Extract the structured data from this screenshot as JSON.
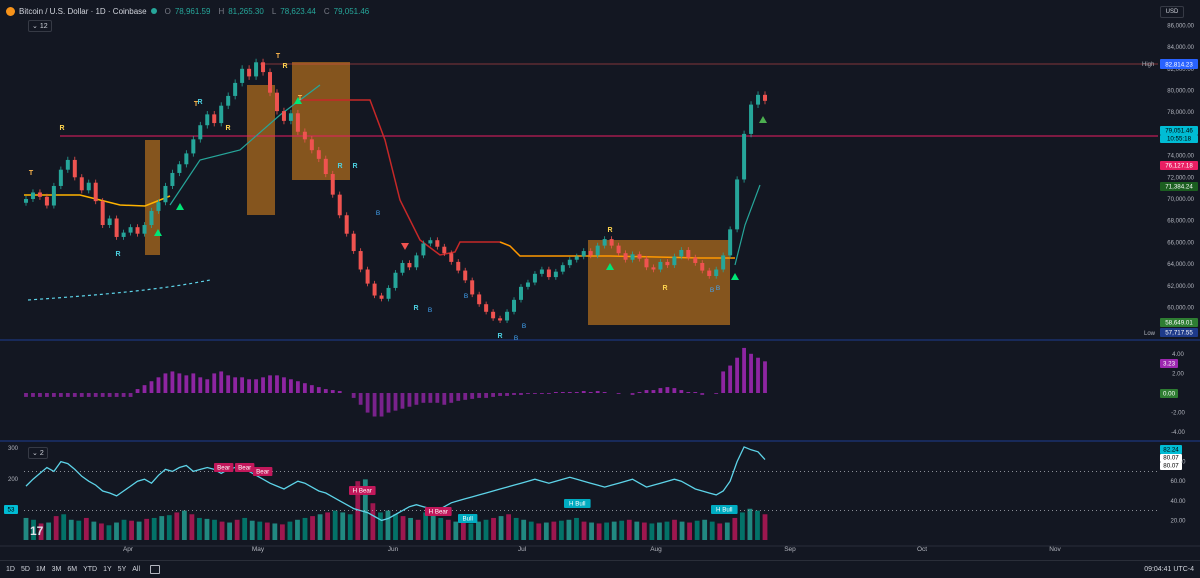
{
  "header": {
    "symbol": "Bitcoin / U.S. Dollar · 1D · Coinbase",
    "open_label": "O",
    "open": "78,961.59",
    "high_label": "H",
    "high": "81,265.30",
    "low_label": "L",
    "low": "78,623.44",
    "close_label": "C",
    "close": "79,051.46",
    "indicator_count": "12",
    "currency": "USD"
  },
  "indicator2": {
    "count": "2"
  },
  "footer": {
    "timeframes": [
      "1D",
      "5D",
      "1M",
      "3M",
      "6M",
      "YTD",
      "1Y",
      "5Y",
      "All"
    ],
    "clock": "09:04:41 UTC-4"
  },
  "colors": {
    "background": "#131722",
    "up": "#26a69a",
    "down": "#ef5350",
    "band": "#f7931a",
    "osc": "#9c27b0",
    "rsi_line": "#5dd3e8"
  },
  "chart_data": [
    {
      "type": "candlestick",
      "title": "Bitcoin / U.S. Dollar · 1D · Coinbase",
      "ylim": [
        57000,
        86500
      ],
      "y_ticks": [
        "86,000.00",
        "84,000.00",
        "82,000.00",
        "80,000.00",
        "78,000.00",
        "74,000.00",
        "72,000.00",
        "70,000.00",
        "68,000.00",
        "66,000.00",
        "64,000.00",
        "62,000.00",
        "60,000.00"
      ],
      "x_ticks": [
        "Apr",
        "May",
        "Jun",
        "Jul",
        "Aug",
        "Sep",
        "Oct",
        "Nov"
      ],
      "close_series": [
        70000,
        70600,
        70200,
        69400,
        71200,
        72700,
        73600,
        72000,
        70800,
        71500,
        69800,
        67600,
        68200,
        66500,
        66900,
        67400,
        66800,
        67600,
        68900,
        69700,
        71200,
        72400,
        73200,
        74200,
        75500,
        76800,
        77800,
        77000,
        78600,
        79500,
        80700,
        82000,
        81300,
        82600,
        81700,
        79800,
        78100,
        77200,
        77900,
        76200,
        75500,
        74500,
        73700,
        72300,
        70400,
        68500,
        66800,
        65200,
        63500,
        62200,
        61100,
        60800,
        61800,
        63200,
        64100,
        63700,
        64800,
        65900,
        66200,
        65600,
        65000,
        64200,
        63400,
        62500,
        61200,
        60300,
        59600,
        59000,
        58800,
        59600,
        60700,
        61900,
        62300,
        63100,
        63500,
        62800,
        63300,
        63900,
        64400,
        64700,
        65200,
        64800,
        65700,
        66300,
        65700,
        65000,
        64400,
        64900,
        64500,
        63700,
        63500,
        64200,
        63900,
        64700,
        65300,
        64600,
        64100,
        63400,
        62900,
        63500,
        64800,
        67200,
        71800,
        76000,
        78700,
        79600,
        79051
      ],
      "price_labels": [
        {
          "label": "High",
          "value": "82,814.23"
        },
        {
          "label": "",
          "value": "79,051.46"
        },
        {
          "label": "",
          "value": "10:55:18"
        },
        {
          "label": "",
          "value": "76,127.18"
        },
        {
          "label": "",
          "value": "71,384.24"
        },
        {
          "label": "",
          "value": "58,649.01"
        },
        {
          "label": "Low",
          "value": "57,717.55"
        }
      ],
      "signals_R": [
        "R",
        "R",
        "R",
        "R",
        "R",
        "R",
        "R",
        "R",
        "R",
        "R",
        "R"
      ],
      "signals_T": [
        "T",
        "T",
        "T",
        "T"
      ],
      "signals_B": [
        "B",
        "B",
        "B",
        "B",
        "B",
        "B",
        "B"
      ]
    },
    {
      "type": "bar",
      "title": "",
      "ylim": [
        -5,
        5
      ],
      "y_ticks": [
        "4.00",
        "2.00",
        "-2.00",
        "-4.00"
      ],
      "values": [
        -0.4,
        -0.4,
        -0.4,
        -0.4,
        -0.4,
        -0.4,
        -0.4,
        -0.4,
        -0.4,
        -0.4,
        -0.4,
        -0.4,
        -0.4,
        -0.4,
        -0.4,
        -0.4,
        0.4,
        0.8,
        1.2,
        1.6,
        2.0,
        2.2,
        2.0,
        1.8,
        2.0,
        1.6,
        1.4,
        2.0,
        2.2,
        1.8,
        1.6,
        1.6,
        1.4,
        1.4,
        1.6,
        1.8,
        1.8,
        1.6,
        1.4,
        1.2,
        1.0,
        0.8,
        0.6,
        0.4,
        0.3,
        0.2,
        0.0,
        -0.5,
        -1.2,
        -2.0,
        -2.4,
        -2.4,
        -2.0,
        -1.8,
        -1.6,
        -1.4,
        -1.2,
        -1.0,
        -1.0,
        -1.0,
        -1.2,
        -1.0,
        -0.8,
        -0.7,
        -0.6,
        -0.5,
        -0.5,
        -0.4,
        -0.3,
        -0.3,
        -0.2,
        -0.2,
        -0.1,
        -0.1,
        -0.1,
        -0.1,
        0.1,
        0.1,
        0.1,
        0.1,
        0.2,
        0.1,
        0.2,
        0.1,
        0.0,
        -0.1,
        0.0,
        -0.2,
        0.1,
        0.3,
        0.3,
        0.5,
        0.6,
        0.5,
        0.3,
        0.1,
        0.1,
        -0.2,
        0.0,
        -0.1,
        2.2,
        2.8,
        3.6,
        4.6,
        4.0,
        3.6,
        3.23
      ],
      "price_labels": [
        {
          "label": "",
          "value": "3.23"
        },
        {
          "label": "",
          "value": "0.00"
        }
      ]
    },
    {
      "type": "line",
      "title": "",
      "ylim": [
        0,
        320
      ],
      "y_ticks_left": [
        "300",
        "200",
        "100"
      ],
      "y_ticks_right": [
        "80.00",
        "60.00",
        "40.00",
        "20.00"
      ],
      "values": [
        55,
        62,
        68,
        74,
        70,
        80,
        78,
        72,
        65,
        60,
        56,
        50,
        48,
        45,
        50,
        55,
        60,
        62,
        58,
        66,
        72,
        70,
        74,
        76,
        70,
        72,
        74,
        72,
        68,
        72,
        74,
        75,
        70,
        66,
        62,
        58,
        55,
        52,
        56,
        60,
        58,
        54,
        50,
        48,
        44,
        40,
        36,
        32,
        30,
        28,
        24,
        20,
        22,
        26,
        30,
        34,
        36,
        34,
        32,
        30,
        34,
        38,
        40,
        42,
        44,
        46,
        48,
        50,
        52,
        54,
        56,
        58,
        60,
        62,
        60,
        58,
        60,
        62,
        64,
        62,
        60,
        58,
        56,
        54,
        56,
        58,
        60,
        62,
        58,
        54,
        56,
        58,
        60,
        62,
        60,
        56,
        52,
        50,
        48,
        46,
        50,
        60,
        80,
        95,
        92,
        90,
        82
      ],
      "volume_values": [
        120,
        110,
        90,
        95,
        130,
        140,
        110,
        105,
        120,
        100,
        90,
        80,
        95,
        110,
        105,
        100,
        115,
        120,
        130,
        135,
        150,
        160,
        140,
        120,
        115,
        110,
        100,
        95,
        110,
        120,
        105,
        100,
        95,
        90,
        85,
        100,
        110,
        120,
        130,
        140,
        150,
        160,
        150,
        140,
        320,
        330,
        200,
        150,
        160,
        140,
        130,
        120,
        110,
        150,
        160,
        120,
        110,
        100,
        95,
        90,
        100,
        110,
        120,
        130,
        140,
        120,
        110,
        100,
        90,
        95,
        100,
        105,
        110,
        120,
        100,
        95,
        90,
        95,
        100,
        105,
        110,
        100,
        95,
        90,
        95,
        100,
        110,
        100,
        95,
        105,
        110,
        100,
        90,
        95,
        120,
        150,
        170,
        160,
        140
      ],
      "annotations": [
        "Bear",
        "Bear",
        "Bear",
        "H Bear",
        "H Bear",
        "Bull",
        "H Bull",
        "H Bull"
      ],
      "price_labels": [
        {
          "label": "",
          "value": "82.24"
        },
        {
          "label": "",
          "value": "80.07"
        },
        {
          "label": "",
          "value": "80.07"
        }
      ],
      "left_badge": "53"
    }
  ]
}
